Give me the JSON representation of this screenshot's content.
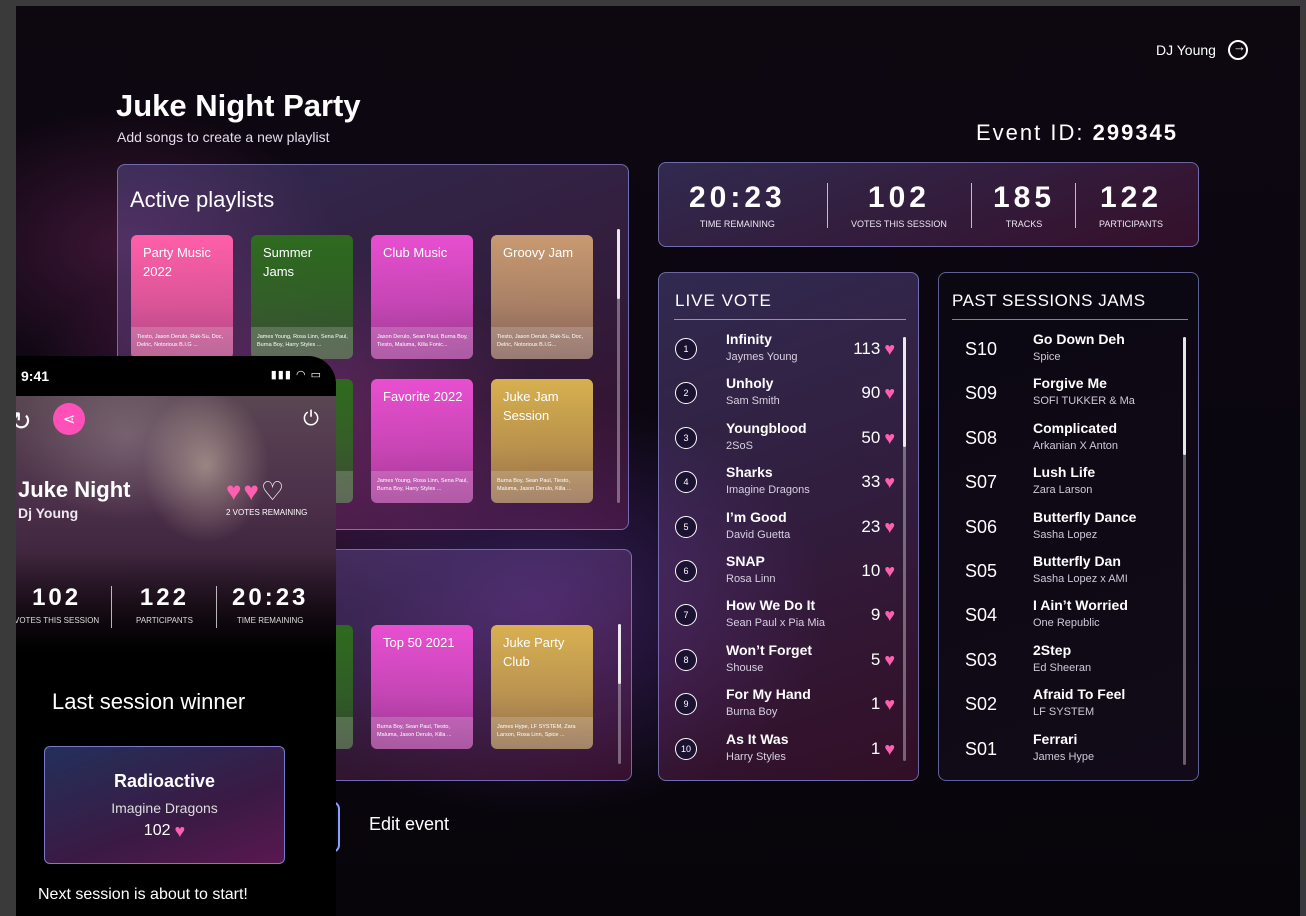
{
  "header": {
    "user": "DJ Young",
    "title": "Juke Night Party",
    "subtitle": "Add songs to create a new playlist",
    "event_id_label": "Event ID:",
    "event_id": "299345"
  },
  "active_playlists": {
    "title": "Active playlists",
    "items": [
      {
        "name": "Party Music 2022",
        "artists": "Tiesto, Jason Derulo, Rak-Su, Doc, Delric, Notorious B.I.G ...",
        "color": "#ff5fa8"
      },
      {
        "name": "Summer Jams",
        "artists": "James Young, Rosa Linn, Sena Paul, Burna Boy, Harry Styles ...",
        "color": "#2e6b1e"
      },
      {
        "name": "Club Music",
        "artists": "Jason Derulo, Sean Paul, Burna Boy, Tiesto, Maluma, Killa Fonic...",
        "color": "#e84fd0"
      },
      {
        "name": "Groovy Jam",
        "artists": "Tiesto, Jason Derulo, Rak-Su, Doc, Delric, Notorious B.I.G...",
        "color": "#c89a70"
      },
      {
        "name": "",
        "artists": "EM, Zara Spice ...",
        "color": "#2e6b1e"
      },
      {
        "name": "Favorite 2022",
        "artists": "James Young, Rosa Linn, Sena Paul, Burna Boy, Harry Styles ...",
        "color": "#e84fd0"
      },
      {
        "name": "Juke Jam Session",
        "artists": "Burna Boy, Sean Paul, Tiesto, Maluma, Jason Derulo, Killa ...",
        "color": "#d8b050"
      }
    ]
  },
  "second_playlists": {
    "items": [
      {
        "name": "od",
        "artists": "inn, Sena y Styles ...",
        "color": "#2e6b1e"
      },
      {
        "name": "Top 50 2021",
        "artists": "Burna Boy, Sean Paul, Tiesto, Maluma, Jason Derulo, Killa ...",
        "color": "#e84fd0"
      },
      {
        "name": "Juke Party Club",
        "artists": "James Hype, LF SYSTEM, Zara Larson, Rosa Linn, Spice ...",
        "color": "#d8b050"
      }
    ]
  },
  "stats": [
    {
      "value": "20:23",
      "label": "TIME REMAINING"
    },
    {
      "value": "102",
      "label": "VOTES THIS SESSION"
    },
    {
      "value": "185",
      "label": "TRACKS"
    },
    {
      "value": "122",
      "label": "PARTICIPANTS"
    }
  ],
  "live_vote": {
    "title": "LIVE VOTE",
    "rows": [
      {
        "rank": "1",
        "song": "Infinity",
        "artist": "Jaymes Young",
        "votes": "113"
      },
      {
        "rank": "2",
        "song": "Unholy",
        "artist": "Sam Smith",
        "votes": "90"
      },
      {
        "rank": "3",
        "song": "Youngblood",
        "artist": "2SoS",
        "votes": "50"
      },
      {
        "rank": "4",
        "song": "Sharks",
        "artist": "Imagine Dragons",
        "votes": "33"
      },
      {
        "rank": "5",
        "song": "I’m Good",
        "artist": "David Guetta",
        "votes": "23"
      },
      {
        "rank": "6",
        "song": "SNAP",
        "artist": "Rosa Linn",
        "votes": "10"
      },
      {
        "rank": "7",
        "song": "How We Do It",
        "artist": "Sean Paul x Pia Mia",
        "votes": "9"
      },
      {
        "rank": "8",
        "song": "Won’t Forget",
        "artist": "Shouse",
        "votes": "5"
      },
      {
        "rank": "9",
        "song": "For My Hand",
        "artist": "Burna Boy",
        "votes": "1"
      },
      {
        "rank": "10",
        "song": "As It Was",
        "artist": "Harry Styles",
        "votes": "1"
      }
    ]
  },
  "past_sessions": {
    "title": "PAST SESSIONS JAMS",
    "rows": [
      {
        "session": "S10",
        "song": "Go Down Deh",
        "artist": "Spice"
      },
      {
        "session": "S09",
        "song": "Forgive Me",
        "artist": "SOFI TUKKER & Ma"
      },
      {
        "session": "S08",
        "song": "Complicated",
        "artist": "Arkanian X Anton"
      },
      {
        "session": "S07",
        "song": "Lush Life",
        "artist": "Zara Larson"
      },
      {
        "session": "S06",
        "song": "Butterfly Dance",
        "artist": "Sasha Lopez"
      },
      {
        "session": "S05",
        "song": "Butterfly Dan",
        "artist": "Sasha Lopez x AMI"
      },
      {
        "session": "S04",
        "song": "I Ain’t Worried",
        "artist": "One Republic"
      },
      {
        "session": "S03",
        "song": "2Step",
        "artist": "Ed Sheeran"
      },
      {
        "session": "S02",
        "song": "Afraid To Feel",
        "artist": "LF SYSTEM"
      },
      {
        "session": "S01",
        "song": "Ferrari",
        "artist": "James Hype"
      }
    ]
  },
  "actions": {
    "edit_event": "Edit event"
  },
  "phone": {
    "time": "9:41",
    "title": "Juke Night",
    "dj": "Dj Young",
    "votes_remaining": "2 VOTES REMAINING",
    "hearts_filled": 2,
    "hearts_total": 3,
    "stats": [
      {
        "value": "102",
        "label": "VOTES THIS SESSION"
      },
      {
        "value": "122",
        "label": "PARTICIPANTS"
      },
      {
        "value": "20:23",
        "label": "TIME REMAINING"
      }
    ],
    "last_winner_label": "Last session winner",
    "winner": {
      "song": "Radioactive",
      "artist": "Imagine Dragons",
      "votes": "102"
    },
    "next": "Next session is about to start!"
  }
}
